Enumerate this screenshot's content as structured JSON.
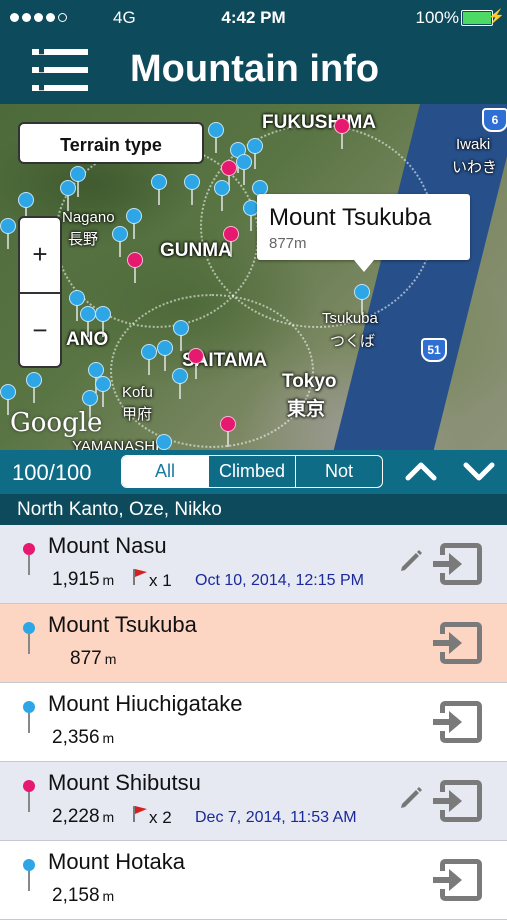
{
  "status_bar": {
    "network": "4G",
    "time": "4:42 PM",
    "battery": "100%"
  },
  "nav": {
    "title": "Mountain info"
  },
  "map": {
    "terrain_button": "Terrain type",
    "zoom_in": "+",
    "zoom_out": "−",
    "google_logo": "Google",
    "labels": [
      "FUKUSHIMA",
      "Nagano",
      "長野",
      "GUNMA",
      "SAITAMA",
      "Tokyo",
      "東京",
      "Tsukuba",
      "つくば",
      "Kofu",
      "甲府",
      "Iwaki",
      "いわき",
      "ANO",
      "YAMANASHI"
    ],
    "road_signs": [
      "6",
      "51"
    ],
    "callout": {
      "title": "Mount Tsukuba",
      "subtitle": "877m"
    }
  },
  "filter": {
    "count": "100/100",
    "options": [
      "All",
      "Climbed",
      "Not"
    ],
    "selected": "All"
  },
  "section": {
    "title": "North Kanto, Oze, Nikko"
  },
  "unit": "m",
  "mountains": [
    {
      "name": "Mount Nasu",
      "elevation": "1,915",
      "climbs": "x 1",
      "date": "Oct 10, 2014, 12:15 PM",
      "pin": "pink",
      "highlight": "#e6e8f2"
    },
    {
      "name": "Mount Tsukuba",
      "elevation": "877",
      "climbs": "",
      "date": "",
      "pin": "blue",
      "highlight": "#fdd5c3"
    },
    {
      "name": "Mount Hiuchigatake",
      "elevation": "2,356",
      "climbs": "",
      "date": "",
      "pin": "blue",
      "highlight": "#ffffff"
    },
    {
      "name": "Mount Shibutsu",
      "elevation": "2,228",
      "climbs": "x 2",
      "date": "Dec 7, 2014, 11:53 AM",
      "pin": "pink",
      "highlight": "#e6e8f2"
    },
    {
      "name": "Mount Hotaka",
      "elevation": "2,158",
      "climbs": "",
      "date": "",
      "pin": "blue",
      "highlight": "#ffffff"
    }
  ],
  "colors": {
    "header": "#0d4a5c",
    "filter_bar": "#0f6c86",
    "pin_blue": "#2ea6e6",
    "pin_pink": "#e6186f",
    "date_text": "#1a2a9a"
  }
}
